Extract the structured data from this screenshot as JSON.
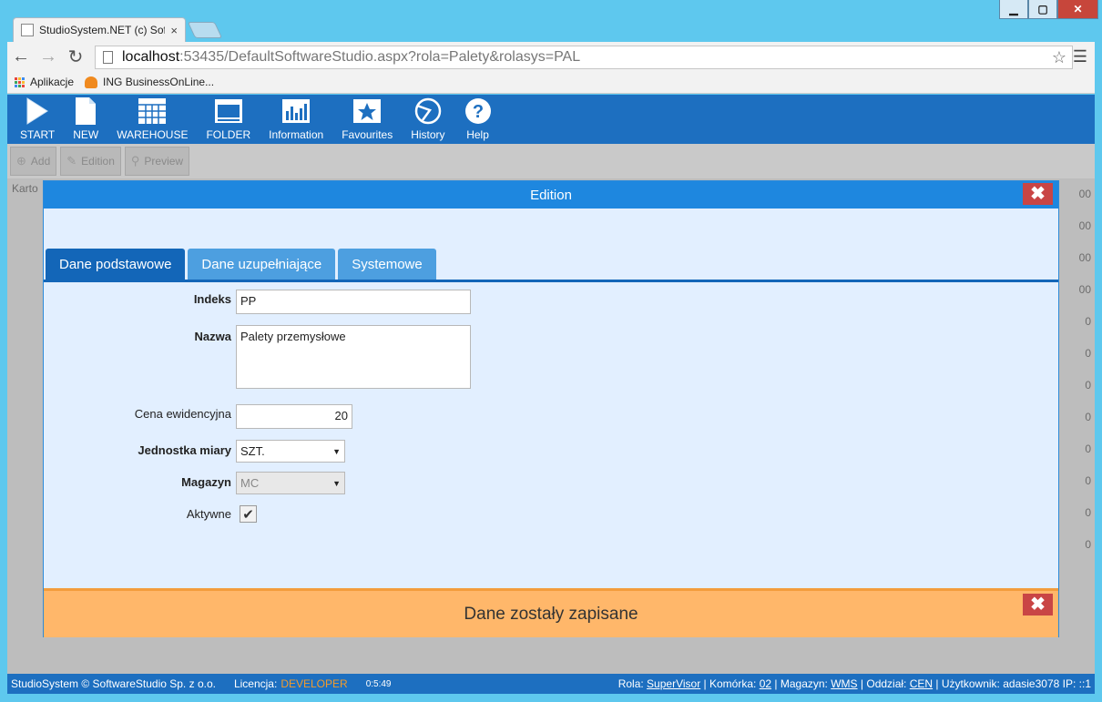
{
  "browser": {
    "tab_title": "StudioSystem.NET (c) Soft",
    "tab_close": "×",
    "url_host": "localhost",
    "url_rest": ":53435/DefaultSoftwareStudio.aspx?rola=Palety&rolasys=PAL",
    "bookmarks": [
      {
        "label": "Aplikacje",
        "icon": "apps-grid-icon"
      },
      {
        "label": "ING BusinessOnLine...",
        "icon": "ing-lion-icon"
      }
    ],
    "window_controls": {
      "minimize": "▁",
      "maximize": "▢",
      "close": "✕"
    }
  },
  "app": {
    "nav": [
      {
        "label": "START",
        "icon": "start-play-icon"
      },
      {
        "label": "NEW",
        "icon": "new-document-icon"
      },
      {
        "label": "WAREHOUSE",
        "icon": "warehouse-grid-icon"
      },
      {
        "label": "FOLDER",
        "icon": "folder-window-icon"
      },
      {
        "label": "Information",
        "icon": "chart-bars-icon"
      },
      {
        "label": "Favourites",
        "icon": "star-icon"
      },
      {
        "label": "History",
        "icon": "history-icon"
      },
      {
        "label": "Help",
        "icon": "help-question-icon"
      }
    ],
    "actions": [
      {
        "label": "Add",
        "icon": "plus-icon"
      },
      {
        "label": "Edition",
        "icon": "edit-icon"
      },
      {
        "label": "Preview",
        "icon": "magnifier-icon"
      }
    ],
    "background": {
      "section_label": "Karto",
      "right_values": [
        "00",
        "00",
        "00",
        "00",
        "0",
        "0",
        "0",
        "0",
        "0",
        "0",
        "0",
        "0"
      ]
    }
  },
  "modal": {
    "title": "Edition",
    "close": "✖",
    "tabs": [
      "Dane podstawowe",
      "Dane uzupełniające",
      "Systemowe"
    ],
    "fields": {
      "indeks_label": "Indeks",
      "indeks_value": "PP",
      "nazwa_label": "Nazwa",
      "nazwa_value": "Palety przemysłowe",
      "cena_label": "Cena ewidencyjna",
      "cena_value": "20",
      "jednostka_label": "Jednostka miary",
      "jednostka_value": "SZT.",
      "magazyn_label": "Magazyn",
      "magazyn_value": "MC",
      "aktywne_label": "Aktywne",
      "aktywne_checked": true
    },
    "notice": "Dane zostały zapisane"
  },
  "status": {
    "copyright": "StudioSystem © SoftwareStudio Sp. z o.o.",
    "licencja_label": "Licencja:",
    "licencja_value": "DEVELOPER",
    "time": "0:5:49",
    "rola_label": "Rola:",
    "rola_value": "SuperVisor",
    "komorka_label": "Komórka:",
    "komorka_value": "02",
    "magazyn_label": "Magazyn:",
    "magazyn_value": "WMS",
    "oddzial_label": "Oddział:",
    "oddzial_value": "CEN",
    "uzytkownik_label": "Użytkownik:",
    "uzytkownik_value": "adasie3078",
    "ip_label": "IP:",
    "ip_value": "::1"
  },
  "colors": {
    "app_blue": "#1d6fc0",
    "modal_header": "#1e87df",
    "notice_bg": "#ffb76a",
    "close_red": "#c94545"
  }
}
